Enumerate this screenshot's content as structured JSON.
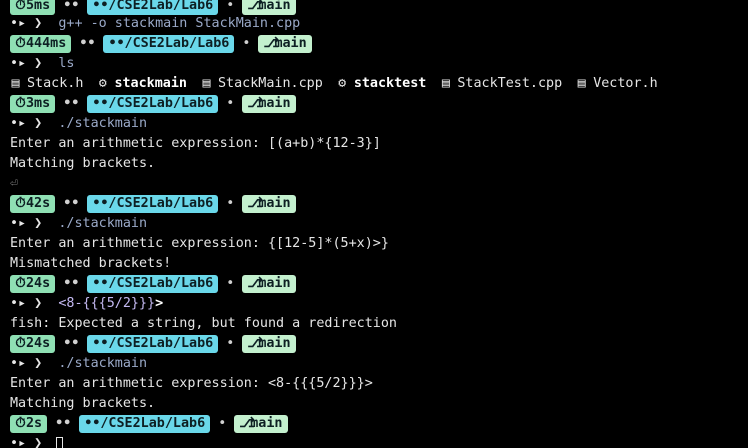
{
  "colors": {
    "background": "#000000",
    "time_pill": "#8fe0b4",
    "dir_pill": "#6ad8ea",
    "branch_pill": "#c3f0ce",
    "command": "#9aa9c8"
  },
  "icons": {
    "timer": "timer-icon",
    "folder": "folder-icon",
    "branch": "git-branch-icon",
    "file": "file-icon",
    "binary": "executable-icon",
    "return": "return-icon"
  },
  "terminal": {
    "lines": [
      {
        "kind": "prompt",
        "time": "5ms",
        "dir": "••/CSE2Lab/Lab6",
        "branch": "main",
        "first": true
      },
      {
        "kind": "command",
        "text": "g++ -o stackmain StackMain.cpp"
      },
      {
        "kind": "prompt",
        "time": "444ms",
        "dir": "••/CSE2Lab/Lab6",
        "branch": "main"
      },
      {
        "kind": "command",
        "text": "ls"
      },
      {
        "kind": "ls",
        "items": [
          {
            "name": "Stack.h",
            "bold": false
          },
          {
            "name": "stackmain",
            "bold": true
          },
          {
            "name": "StackMain.cpp",
            "bold": false
          },
          {
            "name": "stacktest",
            "bold": true
          },
          {
            "name": "StackTest.cpp",
            "bold": false
          },
          {
            "name": "Vector.h",
            "bold": false
          }
        ]
      },
      {
        "kind": "prompt",
        "time": "3ms",
        "dir": "••/CSE2Lab/Lab6",
        "branch": "main"
      },
      {
        "kind": "command",
        "text": "./stackmain"
      },
      {
        "kind": "output",
        "text": "Enter an arithmetic expression: [(a+b)*{12-3}]"
      },
      {
        "kind": "output",
        "text": "Matching brackets."
      },
      {
        "kind": "return",
        "text": "⏎"
      },
      {
        "kind": "prompt",
        "time": "42s",
        "dir": "••/CSE2Lab/Lab6",
        "branch": "main"
      },
      {
        "kind": "command",
        "text": "./stackmain"
      },
      {
        "kind": "output",
        "text": "Enter an arithmetic expression: {[12-5]*(5+x)>}"
      },
      {
        "kind": "output",
        "text": "Mismatched brackets!"
      },
      {
        "kind": "prompt",
        "time": "24s",
        "dir": "••/CSE2Lab/Lab6",
        "branch": "main"
      },
      {
        "kind": "command",
        "text": "<8-{{{5/2}}}",
        "suffix": ">",
        "error": true
      },
      {
        "kind": "output",
        "text": "fish: Expected a string, but found a redirection"
      },
      {
        "kind": "prompt",
        "time": "24s",
        "dir": "••/CSE2Lab/Lab6",
        "branch": "main"
      },
      {
        "kind": "command",
        "text": "./stackmain"
      },
      {
        "kind": "output",
        "text": "Enter an arithmetic expression: <8-{{{5/2}}}>"
      },
      {
        "kind": "output",
        "text": "Matching brackets."
      },
      {
        "kind": "prompt",
        "time": "2s",
        "dir": "••/CSE2Lab/Lab6",
        "branch": "main"
      },
      {
        "kind": "cursor"
      }
    ]
  }
}
